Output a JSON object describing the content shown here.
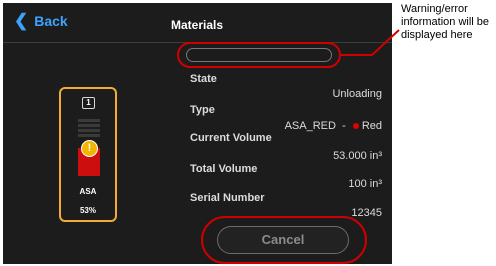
{
  "header": {
    "back_label": "Back",
    "title": "Materials"
  },
  "spool": {
    "slot_number": "1",
    "material": "ASA",
    "percent": "53%",
    "fill_fraction": 0.53,
    "warning_icon": "warning-exclamation-icon",
    "accent_color": "#f0ac35",
    "fill_color": "#cc0e0e"
  },
  "details": {
    "state_label": "State",
    "state_value": "Unloading",
    "type_label": "Type",
    "type_value": "ASA_RED",
    "type_separator": "-",
    "color_name": "Red",
    "current_volume_label": "Current Volume",
    "current_volume_value": "53.000 in³",
    "total_volume_label": "Total Volume",
    "total_volume_value": "100 in³",
    "serial_label": "Serial Number",
    "serial_value": "12345"
  },
  "warning_field": {
    "text": ""
  },
  "buttons": {
    "cancel_label": "Cancel"
  },
  "annotation": {
    "text": "Warning/error information will be displayed here",
    "highlight_color": "#d00000"
  }
}
